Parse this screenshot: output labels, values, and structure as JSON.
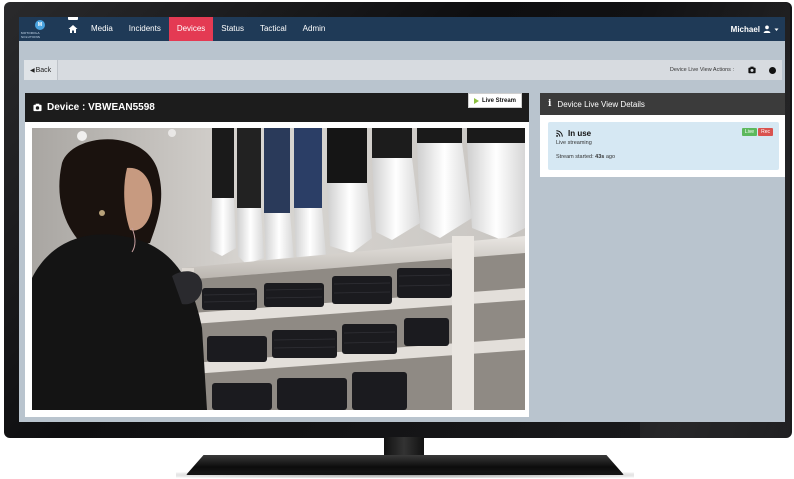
{
  "nav": {
    "logo_text": "MOTOROLA SOLUTIONS",
    "items": [
      {
        "label": "Media",
        "active": false
      },
      {
        "label": "Incidents",
        "active": false
      },
      {
        "label": "Devices",
        "active": true
      },
      {
        "label": "Status",
        "active": false
      },
      {
        "label": "Tactical",
        "active": false
      },
      {
        "label": "Admin",
        "active": false
      }
    ],
    "user": "Michael",
    "icons": {
      "home": "home-icon",
      "user": "user-icon",
      "dropdown": "caret-down-icon"
    }
  },
  "toolbar": {
    "back_label": "Back",
    "actions_label": "Device Live View Actions :",
    "icons": [
      "camera-icon",
      "record-dot-icon"
    ]
  },
  "device": {
    "title": "Device : VBWEAN5598",
    "live_stream_label": "Live Stream",
    "icons": {
      "device": "camera-icon",
      "play": "play-icon"
    }
  },
  "details": {
    "title": "Device Live View Details",
    "status_title": "In use",
    "status_sub": "Live streaming",
    "stream_started_label": "Stream started:",
    "stream_started_value": "43s",
    "stream_started_suffix": "ago",
    "badges": [
      "Live",
      "Rec"
    ],
    "icons": {
      "info": "info-icon",
      "feed": "rss-feed-icon"
    }
  },
  "colors": {
    "nav_bg": "#1f3a57",
    "nav_active": "#e43a53",
    "screen_bg": "#b9c4ce",
    "status_card": "#d6e8f3",
    "badge_live": "#5cb85c",
    "badge_rec": "#d9534f",
    "play_icon": "#8bbf3f"
  }
}
